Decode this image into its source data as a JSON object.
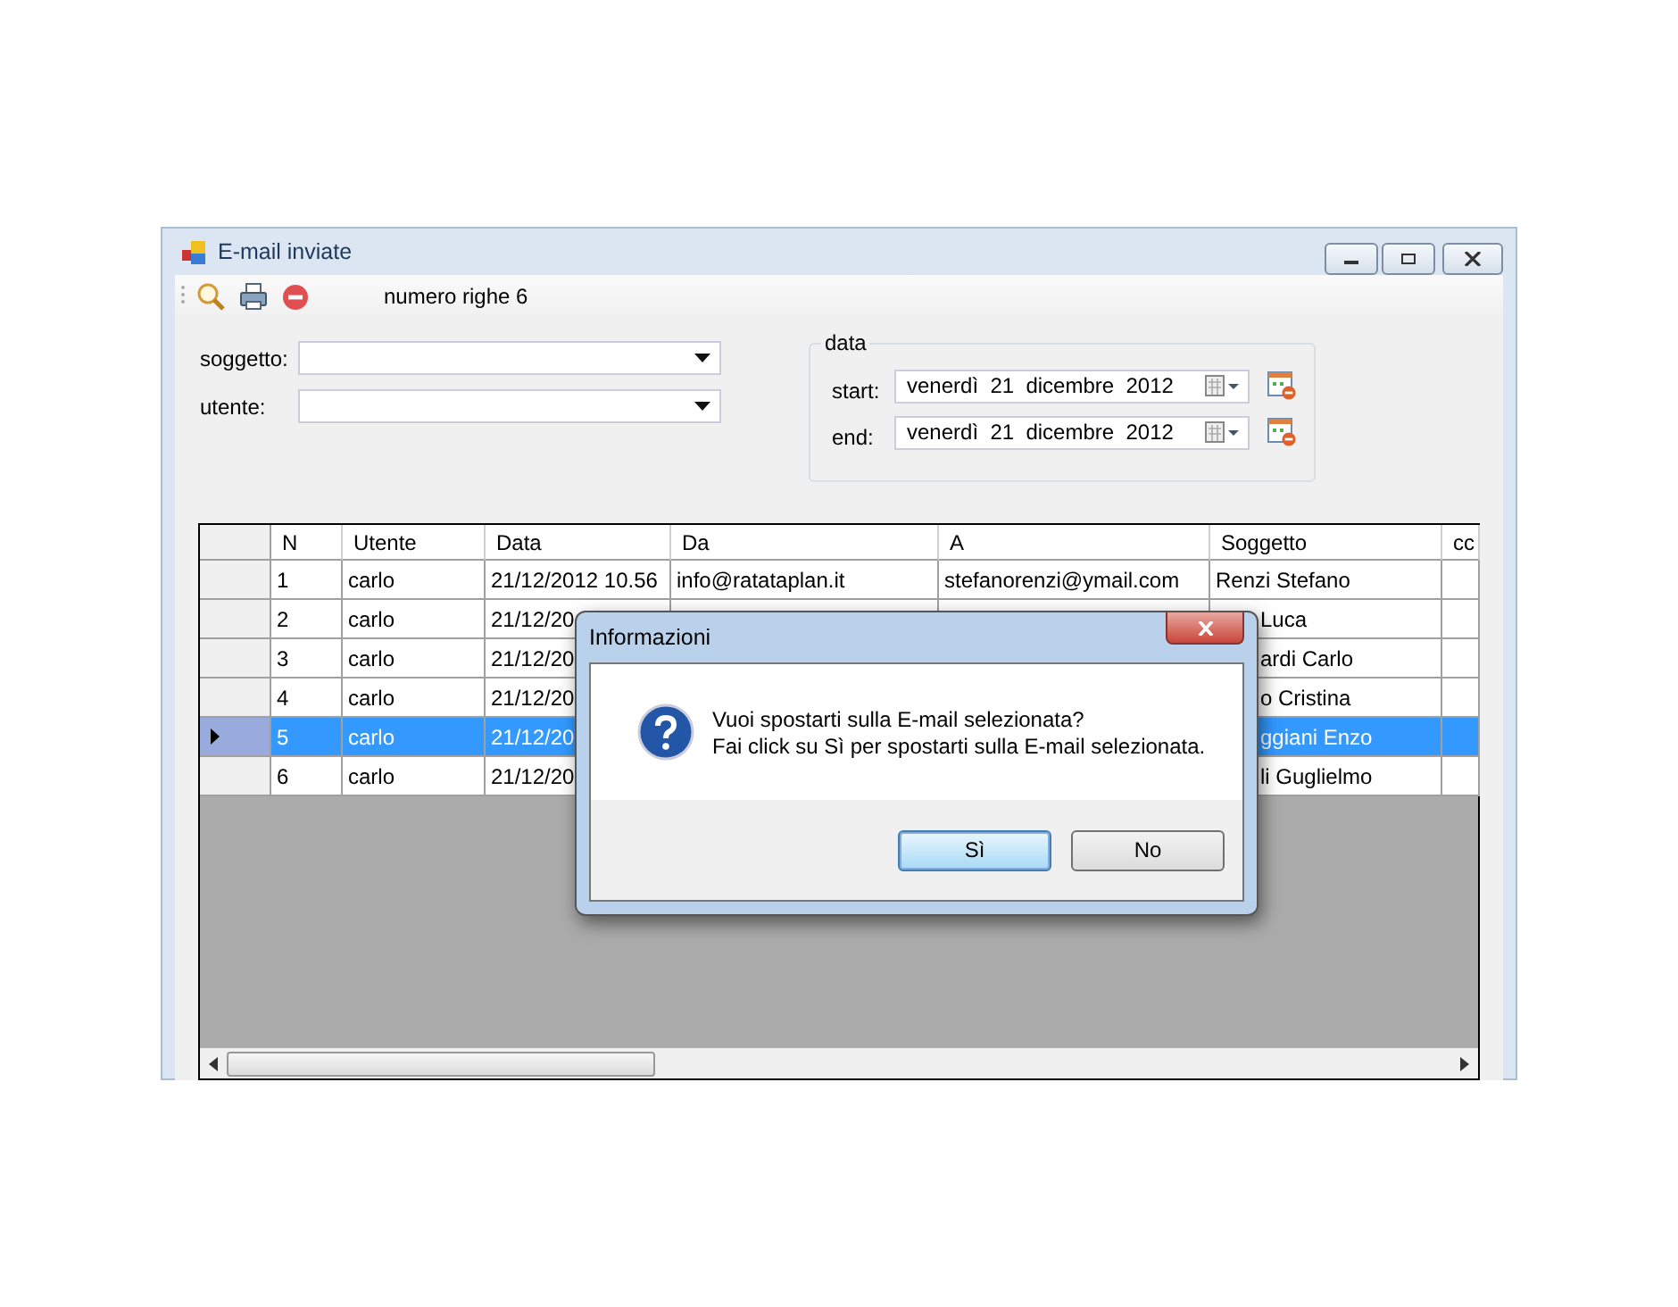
{
  "window": {
    "title": "E-mail inviate"
  },
  "toolbar": {
    "row_count": "numero righe 6"
  },
  "filters": [
    {
      "label": "soggetto:"
    },
    {
      "label": "utente:"
    }
  ],
  "date_group": {
    "title": "data",
    "fields": [
      {
        "label": "start:",
        "value": "venerdì  21  dicembre  2012"
      },
      {
        "label": "end:",
        "value": "venerdì  21  dicembre  2012"
      }
    ]
  },
  "table": {
    "columns": [
      "N",
      "Utente",
      "Data",
      "Da",
      "A",
      "Soggetto",
      "cc"
    ],
    "rows": [
      {
        "selected": false,
        "n": "1",
        "utente": "carlo",
        "data": "21/12/2012 10.56",
        "da": "info@ratataplan.it",
        "a": "stefanorenzi@ymail.com",
        "soggetto": "Renzi Stefano"
      },
      {
        "selected": false,
        "n": "2",
        "utente": "carlo",
        "data": "21/12/20",
        "soggetto": "Luca"
      },
      {
        "selected": false,
        "n": "3",
        "utente": "carlo",
        "data": "21/12/20",
        "soggetto": "ardi Carlo"
      },
      {
        "selected": false,
        "n": "4",
        "utente": "carlo",
        "data": "21/12/20",
        "soggetto": "o Cristina"
      },
      {
        "selected": true,
        "n": "5",
        "utente": "carlo",
        "data": "21/12/20",
        "soggetto": "ggiani Enzo"
      },
      {
        "selected": false,
        "n": "6",
        "utente": "carlo",
        "data": "21/12/20",
        "soggetto": "li Guglielmo"
      }
    ]
  },
  "dialog": {
    "title": "Informazioni",
    "lines": [
      "Vuoi spostarti sulla E-mail selezionata?",
      "Fai click su Sì per spostarti sulla E-mail selezionata."
    ],
    "buttons": [
      {
        "label": "Sì",
        "selected": true
      },
      {
        "label": "No",
        "selected": false
      }
    ]
  }
}
